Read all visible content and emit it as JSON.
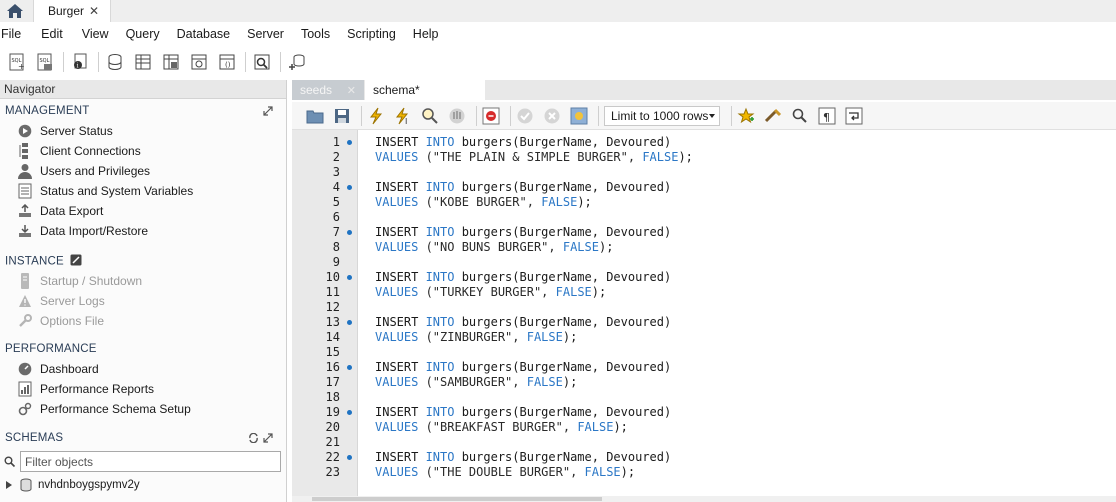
{
  "tabs": {
    "home_icon": "home-icon",
    "connection_tab": "Burger"
  },
  "menu": [
    "File",
    "Edit",
    "View",
    "Query",
    "Database",
    "Server",
    "Tools",
    "Scripting",
    "Help"
  ],
  "navigator": {
    "title": "Navigator",
    "management": {
      "heading": "MANAGEMENT",
      "items": [
        "Server Status",
        "Client Connections",
        "Users and Privileges",
        "Status and System Variables",
        "Data Export",
        "Data Import/Restore"
      ]
    },
    "instance": {
      "heading": "INSTANCE",
      "items": [
        "Startup / Shutdown",
        "Server Logs",
        "Options File"
      ]
    },
    "performance": {
      "heading": "PERFORMANCE",
      "items": [
        "Dashboard",
        "Performance Reports",
        "Performance Schema Setup"
      ]
    },
    "schemas": {
      "heading": "SCHEMAS",
      "filter_placeholder": "Filter objects",
      "items": [
        "nvhdnboygspymv2y"
      ]
    }
  },
  "editor": {
    "tabs": [
      "seeds",
      "schema*"
    ],
    "limit_select": "Limit to 1000 rows",
    "line_numbers": [
      "1",
      "2",
      "3",
      "4",
      "5",
      "6",
      "7",
      "8",
      "9",
      "10",
      "11",
      "12",
      "13",
      "14",
      "15",
      "16",
      "17",
      "18",
      "19",
      "20",
      "21",
      "22",
      "23"
    ],
    "statements": [
      {
        "insert_pre": "INSERT ",
        "into": "INTO",
        "insert_post": " burgers(BurgerName, Devoured)",
        "values_kw": "VALUES",
        "values_pre": " (\"THE PLAIN & SIMPLE BURGER\", ",
        "false_kw": "FALSE",
        "values_post": ");"
      },
      {
        "insert_pre": "INSERT ",
        "into": "INTO",
        "insert_post": " burgers(BurgerName, Devoured)",
        "values_kw": "VALUES",
        "values_pre": " (\"KOBE BURGER\", ",
        "false_kw": "FALSE",
        "values_post": ");"
      },
      {
        "insert_pre": "INSERT ",
        "into": "INTO",
        "insert_post": " burgers(BurgerName, Devoured)",
        "values_kw": "VALUES",
        "values_pre": " (\"NO BUNS BURGER\", ",
        "false_kw": "FALSE",
        "values_post": ");"
      },
      {
        "insert_pre": "INSERT ",
        "into": "INTO",
        "insert_post": " burgers(BurgerName, Devoured)",
        "values_kw": "VALUES",
        "values_pre": " (\"TURKEY BURGER\", ",
        "false_kw": "FALSE",
        "values_post": ");"
      },
      {
        "insert_pre": "INSERT ",
        "into": "INTO",
        "insert_post": " burgers(BurgerName, Devoured)",
        "values_kw": "VALUES",
        "values_pre": " (\"ZINBURGER\", ",
        "false_kw": "FALSE",
        "values_post": ");"
      },
      {
        "insert_pre": "INSERT ",
        "into": "INTO",
        "insert_post": " burgers(BurgerName, Devoured)",
        "values_kw": "VALUES",
        "values_pre": " (\"SAMBURGER\", ",
        "false_kw": "FALSE",
        "values_post": ");"
      },
      {
        "insert_pre": "INSERT ",
        "into": "INTO",
        "insert_post": " burgers(BurgerName, Devoured)",
        "values_kw": "VALUES",
        "values_pre": " (\"BREAKFAST BURGER\", ",
        "false_kw": "FALSE",
        "values_post": ");"
      },
      {
        "insert_pre": "INSERT ",
        "into": "INTO",
        "insert_post": " burgers(BurgerName, Devoured)",
        "values_kw": "VALUES",
        "values_pre": " (\"THE DOUBLE BURGER\", ",
        "false_kw": "FALSE",
        "values_post": ");"
      }
    ]
  },
  "colors": {
    "keyword": "#2b77c6",
    "statement_dot": "#1f73c2",
    "section_heading": "#2a3d56"
  }
}
